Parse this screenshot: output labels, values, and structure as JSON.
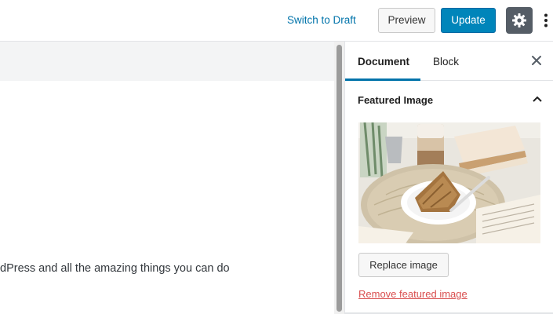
{
  "header": {
    "switch_to_draft": "Switch to Draft",
    "preview": "Preview",
    "update": "Update"
  },
  "editor": {
    "content_line": "dPress and all the amazing things you can do"
  },
  "sidebar": {
    "tabs": [
      {
        "label": "Document",
        "active": true
      },
      {
        "label": "Block",
        "active": false
      }
    ],
    "panel": {
      "title": "Featured Image",
      "replace_button": "Replace image",
      "remove_link": "Remove featured image"
    }
  },
  "icons": {
    "settings": "gear-icon",
    "more": "vertical-ellipsis-icon",
    "close": "close-icon",
    "collapse": "chevron-up-icon"
  },
  "colors": {
    "accent": "#0073aa",
    "update_button": "#0085ba",
    "settings_button": "#555d66",
    "remove_link": "#d94f4f"
  }
}
